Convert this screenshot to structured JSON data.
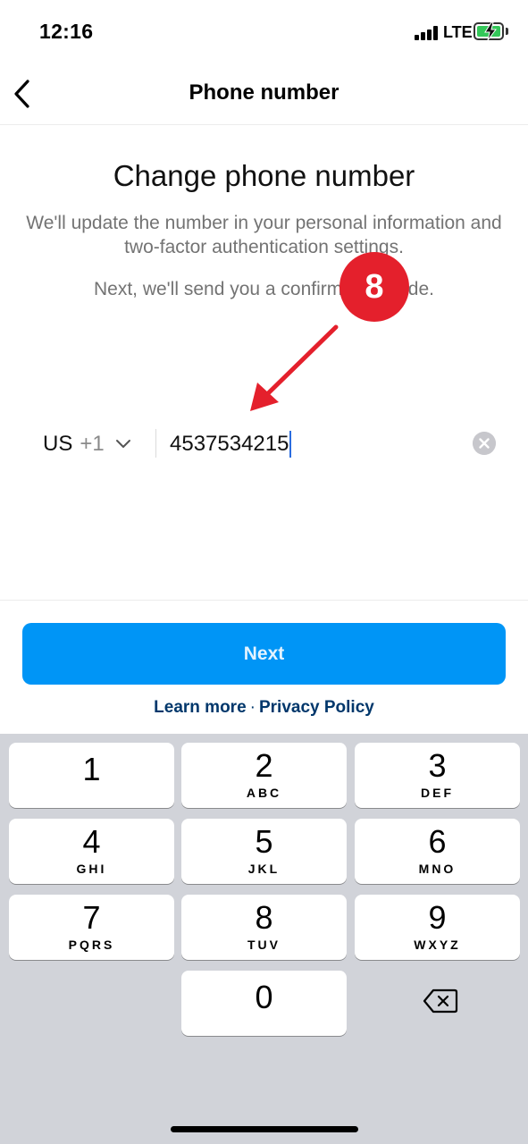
{
  "status_bar": {
    "time": "12:16",
    "network": "LTE",
    "icons": [
      "signal-icon",
      "battery-charging-icon"
    ]
  },
  "nav": {
    "title": "Phone number",
    "back_icon": "back-chevron-icon"
  },
  "content": {
    "heading": "Change phone number",
    "description": "We'll update the number in your personal information and two-factor authentication settings.",
    "note": "Next, we'll send you a confirmation code."
  },
  "phone": {
    "country": "US",
    "dial_code": "+1",
    "number": "4537534215"
  },
  "annotation": {
    "step": "8",
    "color": "#e4202c"
  },
  "actions": {
    "next_label": "Next",
    "learn_more": "Learn more",
    "separator": "·",
    "privacy_policy": "Privacy Policy",
    "accent_color": "#0095f6"
  },
  "keypad": {
    "keys": [
      {
        "num": "1",
        "letters": ""
      },
      {
        "num": "2",
        "letters": "ABC"
      },
      {
        "num": "3",
        "letters": "DEF"
      },
      {
        "num": "4",
        "letters": "GHI"
      },
      {
        "num": "5",
        "letters": "JKL"
      },
      {
        "num": "6",
        "letters": "MNO"
      },
      {
        "num": "7",
        "letters": "PQRS"
      },
      {
        "num": "8",
        "letters": "TUV"
      },
      {
        "num": "9",
        "letters": "WXYZ"
      },
      {
        "num": "0",
        "letters": ""
      }
    ]
  }
}
